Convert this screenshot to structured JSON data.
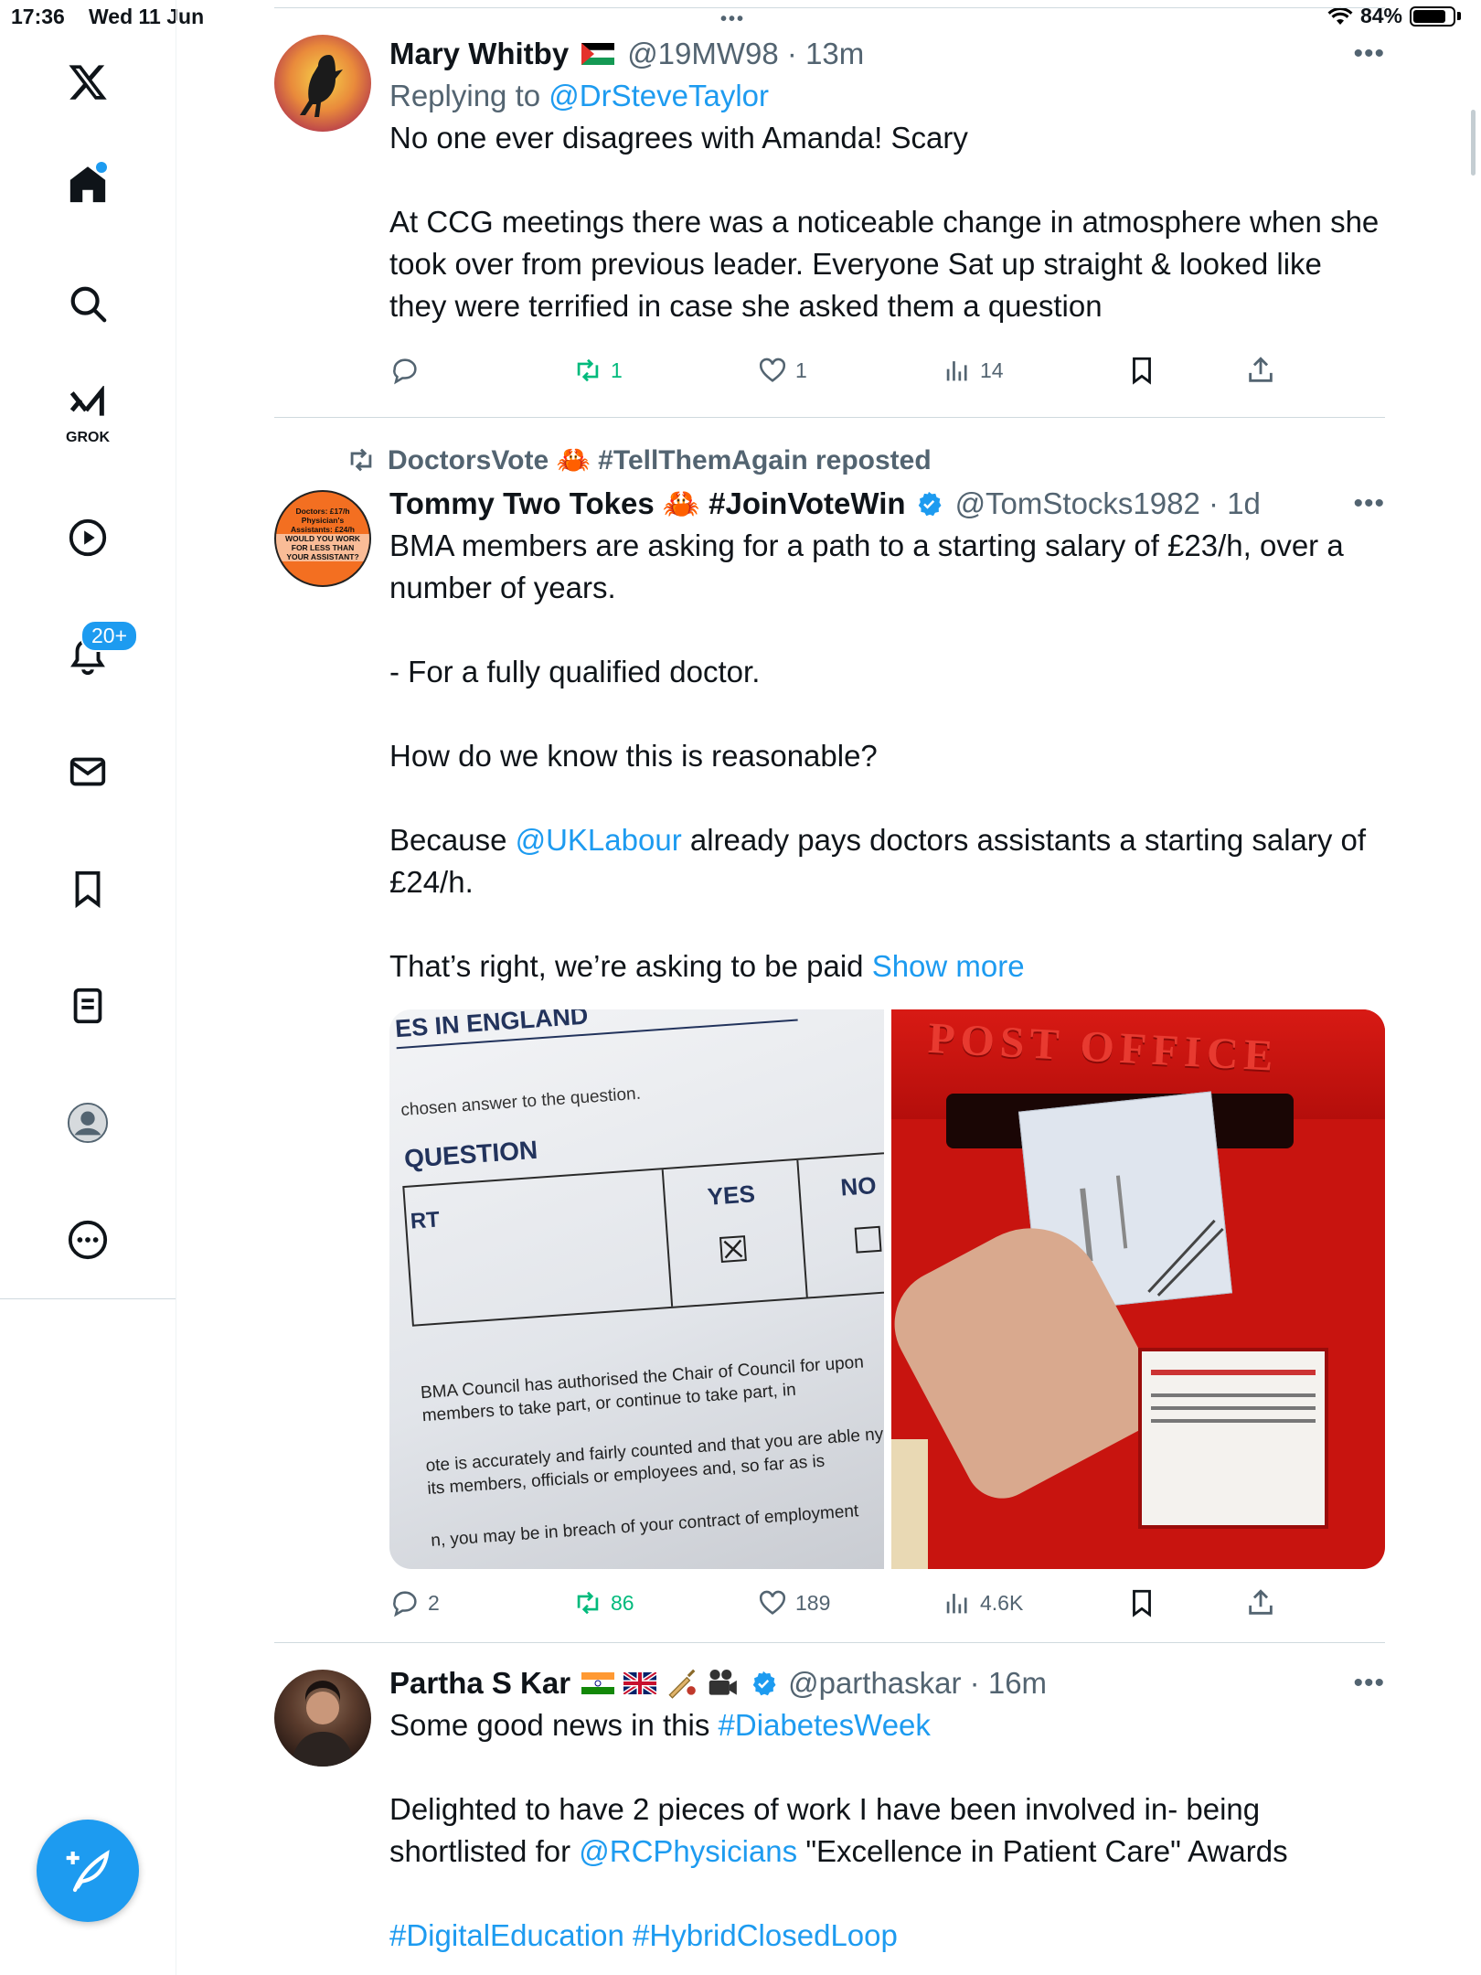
{
  "status_bar": {
    "time": "17:36",
    "date": "Wed 11 Jun",
    "battery": "84%",
    "battery_level": 0.84,
    "dots": "•••"
  },
  "sidebar": {
    "logo": "x-logo-icon",
    "grok_label": "GROK",
    "notifications_badge": "20+",
    "items": [
      "home-icon",
      "search-icon",
      "grok-icon",
      "video-icon",
      "bell-icon",
      "mail-icon",
      "bookmark-icon",
      "lists-icon",
      "profile-icon",
      "more-icon"
    ]
  },
  "tweets": [
    {
      "name": "Mary Whitby",
      "handle": "@19MW98",
      "time": "13m",
      "reply_prefix": "Replying to ",
      "reply_to": "@DrSteveTaylor",
      "text": "No one ever disagrees with Amanda! Scary\n\nAt CCG meetings there was a noticeable change in atmosphere when she took over from previous leader. Everyone Sat up straight & looked like they were terrified in case she asked them a question",
      "replies": "",
      "retweets": "1",
      "likes": "1",
      "views": "14"
    },
    {
      "repost_label": "DoctorsVote 🦀 #TellThemAgain reposted",
      "name": "Tommy Two Tokes 🦀 #JoinVoteWin",
      "handle": "@TomStocks1982",
      "time": "1d",
      "text_1": "BMA members are asking for a path to a starting salary of £23/h, over a number of years.\n\n- For a fully qualified doctor.\n\nHow do we know this is reasonable?\n\nBecause ",
      "mention": "@UKLabour",
      "text_2": " already pays doctors assistants a starting salary of £24/h.\n\nThat’s right, we’re asking to be paid ",
      "show_more": "Show more",
      "avatar_text": [
        "Doctors: £17/h",
        "Physician's",
        "Assistants: £24/h",
        "WOULD YOU WORK",
        "FOR LESS THAN",
        "YOUR ASSISTANT?"
      ],
      "ballot": {
        "header": "ES IN ENGLAND",
        "instruction": "chosen answer to the question.",
        "question": "QUESTION",
        "row": "RT",
        "yes": "YES",
        "no": "NO",
        "para1": "BMA Council has authorised the Chair of Council for upon members to take part, or continue to take part, in",
        "para2": "ote is accurately and fairly counted and that you are able ny of its members, officials or employees and, so far as is",
        "para3": "n, you may be in breach of your contract of employment"
      },
      "postbox": {
        "sign": "POST OFFICE"
      },
      "replies": "2",
      "retweets": "86",
      "likes": "189",
      "views": "4.6K"
    },
    {
      "name": "Partha S Kar",
      "handle": "@parthaskar",
      "time": "16m",
      "text_1": "Some good news in this ",
      "hashtag_1": "#DiabetesWeek",
      "text_2": "\n\nDelighted to have 2 pieces of work I have been involved in- being shortlisted for ",
      "mention": "@RCPhysicians",
      "text_3": " \"Excellence in Patient Care\" Awards",
      "hashtag_2": "#DigitalEducation",
      "hashtag_3": "#HybridClosedLoop"
    }
  ],
  "colors": {
    "accent": "#1d9bf0",
    "retweet_green": "#00ba7c",
    "muted": "#536471"
  }
}
